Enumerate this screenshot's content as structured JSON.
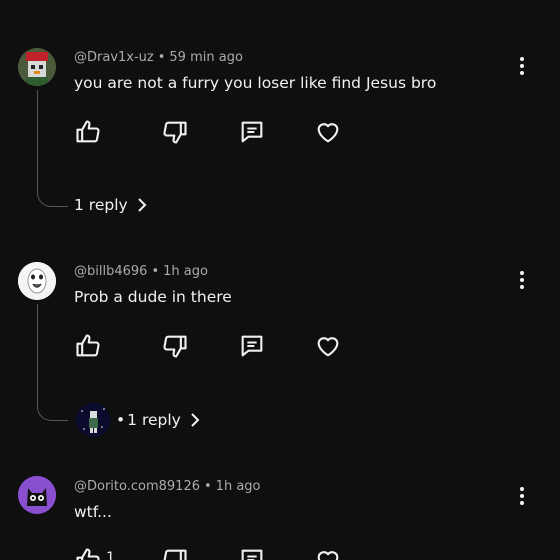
{
  "comments": [
    {
      "handle": "@Drav1x-uz",
      "time": "59 min ago",
      "text": "you are not a furry you loser like find Jesus bro",
      "replies": "1 reply"
    },
    {
      "handle": "@billb4696",
      "time": "1h ago",
      "text": "Prob a dude in there",
      "replies": "1 reply"
    },
    {
      "handle": "@Dorito.com89126",
      "time": "1h ago",
      "text": "wtf...",
      "like_count": "1"
    }
  ],
  "separator": "•",
  "icons": [
    "thumbs-up-icon",
    "thumbs-down-icon",
    "reply-icon",
    "heart-icon",
    "more-vert-icon",
    "chevron-right-icon"
  ]
}
